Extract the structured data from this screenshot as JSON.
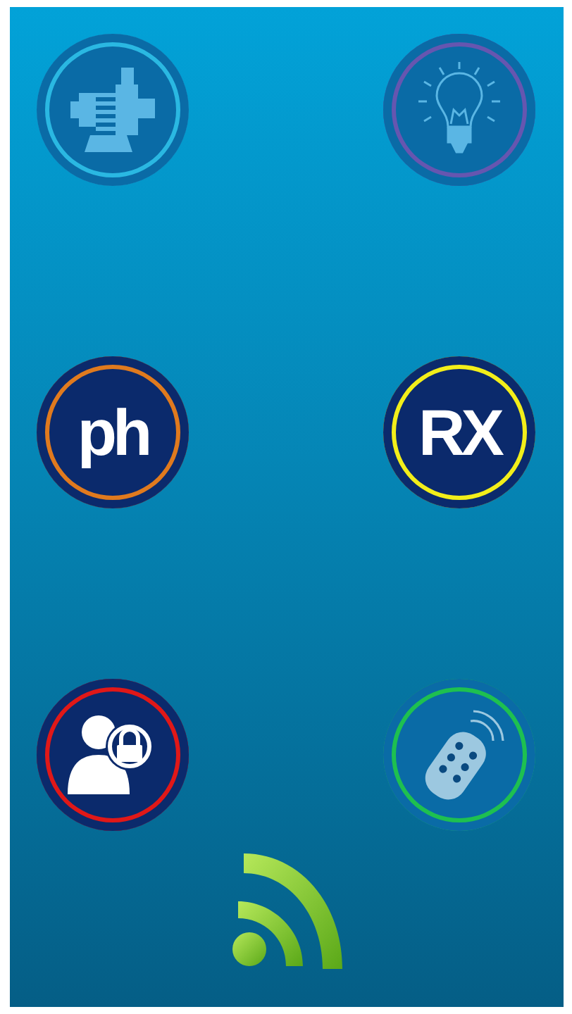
{
  "buttons": [
    {
      "kind": "motor",
      "color": "#2ab8e2",
      "disabled": true
    },
    {
      "kind": "bulb",
      "color": "#6656b0",
      "disabled": true
    },
    {
      "kind": "text",
      "label": "ph",
      "color": "#e07a1e",
      "disabled": false
    },
    {
      "kind": "text",
      "label": "RX",
      "color": "#f2ee1a",
      "disabled": false
    },
    {
      "kind": "user-lock",
      "color": "#e01818",
      "disabled": false
    },
    {
      "kind": "remote",
      "color": "#1ec050",
      "disabled": true
    }
  ]
}
